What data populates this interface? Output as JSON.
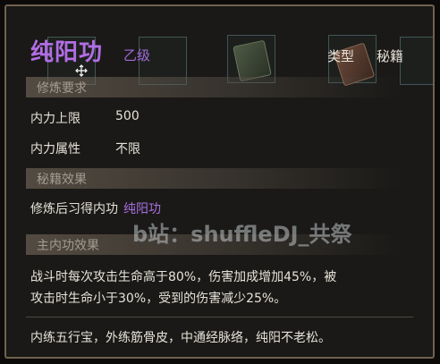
{
  "tooltip": {
    "title": "纯阳功",
    "grade": "乙级",
    "type_label": "类型",
    "type_value": "秘籍",
    "requirements": {
      "header": "修炼要求",
      "rows": [
        {
          "label": "内力上限",
          "value": "500"
        },
        {
          "label": "内力属性",
          "value": "不限"
        }
      ]
    },
    "manual_effect": {
      "header": "秘籍效果",
      "text": "修炼后习得内功",
      "skill": "纯阳功"
    },
    "main_effect": {
      "header": "主内功效果",
      "line1": "战斗时每次攻击生命高于80%，伤害加成增加45%，被",
      "line2": "攻击时生命小于30%，受到的伤害减少25%。"
    },
    "lore": "内练五行宝，外练筋骨皮，中通经脉络，纯阳不老松。"
  },
  "watermark": "b站：shuffleDJ_共祭",
  "colors": {
    "title": "#b26de4",
    "grade": "#a06ad8",
    "text": "#e6e2d8",
    "section_text": "#a39c90",
    "frame": "#6f6150",
    "background": "#1a1917"
  },
  "icons": [
    "move-cursor-icon",
    "manual-book-icon"
  ]
}
